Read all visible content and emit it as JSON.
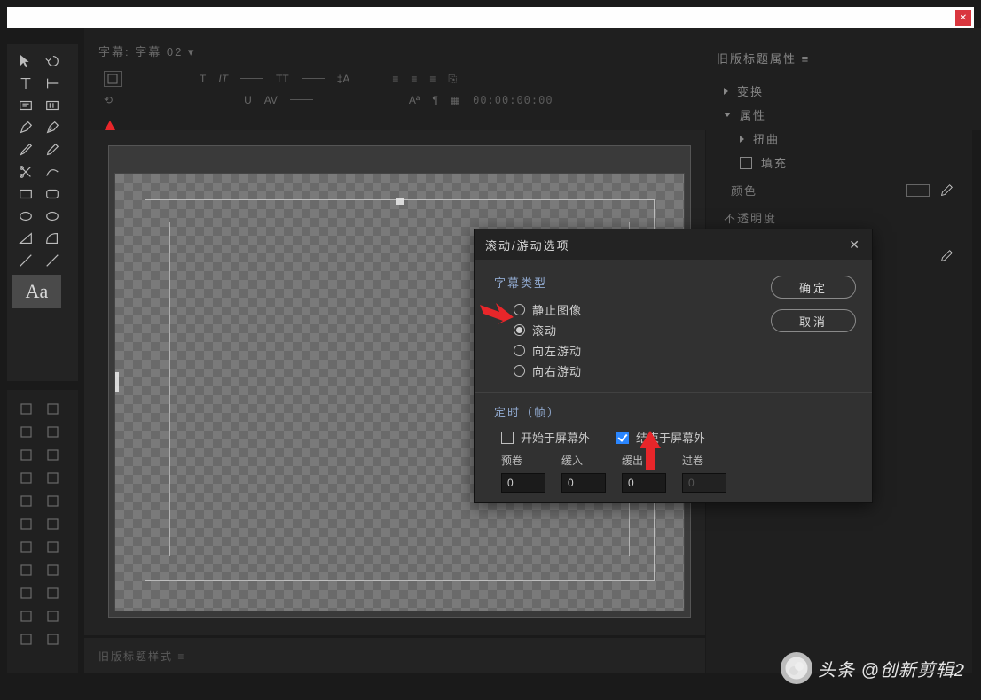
{
  "titlebar": {
    "close_icon": "✕"
  },
  "left_tools_primary": [
    "arrow-icon",
    "undo-icon",
    "text-icon",
    "vtext-icon",
    "textbox-icon",
    "textbox2-icon",
    "pen-icon",
    "pen2-icon",
    "brush-icon",
    "eyedrop-icon",
    "scissors-icon",
    "path-icon",
    "rect-icon",
    "roundrect-icon",
    "ellipse-icon",
    "ellipse2-icon",
    "triangle-icon",
    "arc-icon",
    "line-icon",
    "line2-icon"
  ],
  "left_tools_big": {
    "label": "Aa"
  },
  "left_tools_secondary_count": 22,
  "top_bar": {
    "tab_label": "字幕: 字幕 02 ▾",
    "timecode": "00:00:00:00"
  },
  "right_panel": {
    "title": "旧版标题属性 ≡",
    "items": [
      {
        "kind": "expand",
        "label": "变换"
      },
      {
        "kind": "expand",
        "label": "属性"
      },
      {
        "kind": "sub",
        "label": "扭曲"
      },
      {
        "kind": "check",
        "label": "填充"
      }
    ],
    "color_label": "颜色",
    "opacity_label": "不透明度"
  },
  "bottom_bar": {
    "label": "旧版标题样式 ≡"
  },
  "dialog": {
    "title": "滚动/游动选项",
    "close": "✕",
    "group1_label": "字幕类型",
    "radios": [
      {
        "label": "静止图像",
        "selected": false
      },
      {
        "label": "滚动",
        "selected": true
      },
      {
        "label": "向左游动",
        "selected": false
      },
      {
        "label": "向右游动",
        "selected": false
      }
    ],
    "group2_label": "定时（帧）",
    "chk_start": {
      "label": "开始于屏幕外",
      "on": false
    },
    "chk_end": {
      "label": "结束于屏幕外",
      "on": true
    },
    "cols": [
      {
        "label": "预卷",
        "value": "0",
        "disabled": false
      },
      {
        "label": "缓入",
        "value": "0",
        "disabled": false
      },
      {
        "label": "缓出",
        "value": "0",
        "disabled": false
      },
      {
        "label": "过卷",
        "value": "0",
        "disabled": true
      }
    ],
    "btn_ok": "确定",
    "btn_cancel": "取消"
  },
  "watermark": {
    "text": "头条 @创新剪辑2"
  }
}
